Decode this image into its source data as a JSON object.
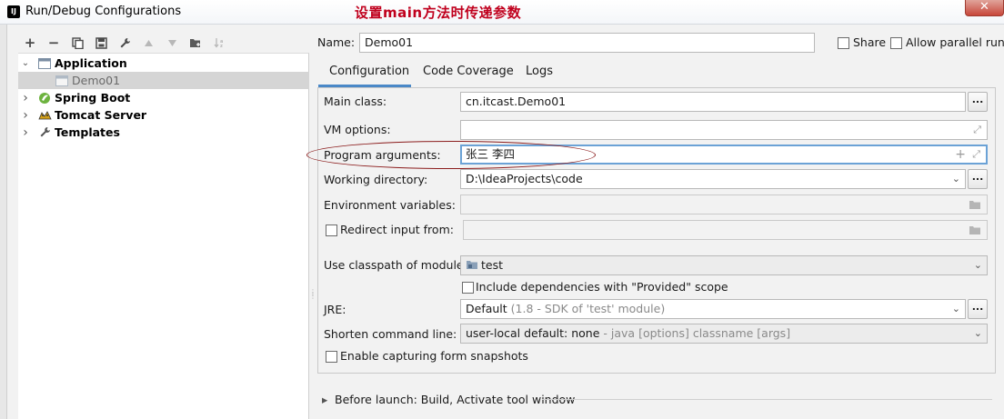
{
  "window": {
    "title": "Run/Debug Configurations",
    "annotation": "设置main方法时传递参数",
    "close_glyph": "✕",
    "app_icon_text": "IJ"
  },
  "toolbar": {
    "add": "+",
    "remove": "−",
    "copy": "⧉",
    "save": "💾",
    "edit": "🔧",
    "up": "▲",
    "down": "▼",
    "folder": "📁",
    "sort": "↓²"
  },
  "tree": {
    "items": [
      {
        "label": "Application",
        "arrow": "⌄",
        "expanded": true
      },
      {
        "label": "Demo01",
        "arrow": ""
      },
      {
        "label": "Spring Boot",
        "arrow": "›"
      },
      {
        "label": "Tomcat Server",
        "arrow": "›"
      },
      {
        "label": "Templates",
        "arrow": "›"
      }
    ]
  },
  "header": {
    "name_label": "Name:",
    "name_value": "Demo01",
    "share_label": "Share",
    "allow_parallel_label": "Allow parallel run"
  },
  "tabs": [
    {
      "label": "Configuration",
      "active": true
    },
    {
      "label": "Code Coverage",
      "active": false
    },
    {
      "label": "Logs",
      "active": false
    }
  ],
  "form": {
    "main_class_label": "Main class:",
    "main_class_value": "cn.itcast.Demo01",
    "vm_options_label": "VM options:",
    "vm_options_value": "",
    "program_args_label": "Program arguments:",
    "program_args_value": "张三  李四",
    "working_dir_label": "Working directory:",
    "working_dir_value": "D:\\IdeaProjects\\code",
    "env_vars_label": "Environment variables:",
    "redirect_label": "Redirect input from:",
    "classpath_label": "Use classpath of module:",
    "classpath_value": "test",
    "include_deps_label": "Include dependencies with \"Provided\" scope",
    "jre_label": "JRE:",
    "jre_value": "Default",
    "jre_hint": "(1.8 - SDK of 'test' module)",
    "shorten_label": "Shorten command line:",
    "shorten_value": "user-local default: none",
    "shorten_hint": "- java [options] classname [args]",
    "snapshots_label": "Enable capturing form snapshots",
    "dots": "...",
    "expand_glyph": "⤢",
    "plus_glyph": "+",
    "chevron_glyph": "⌄"
  },
  "before_launch": {
    "label": "Before launch: Build, Activate tool window",
    "arrow": "▸"
  }
}
